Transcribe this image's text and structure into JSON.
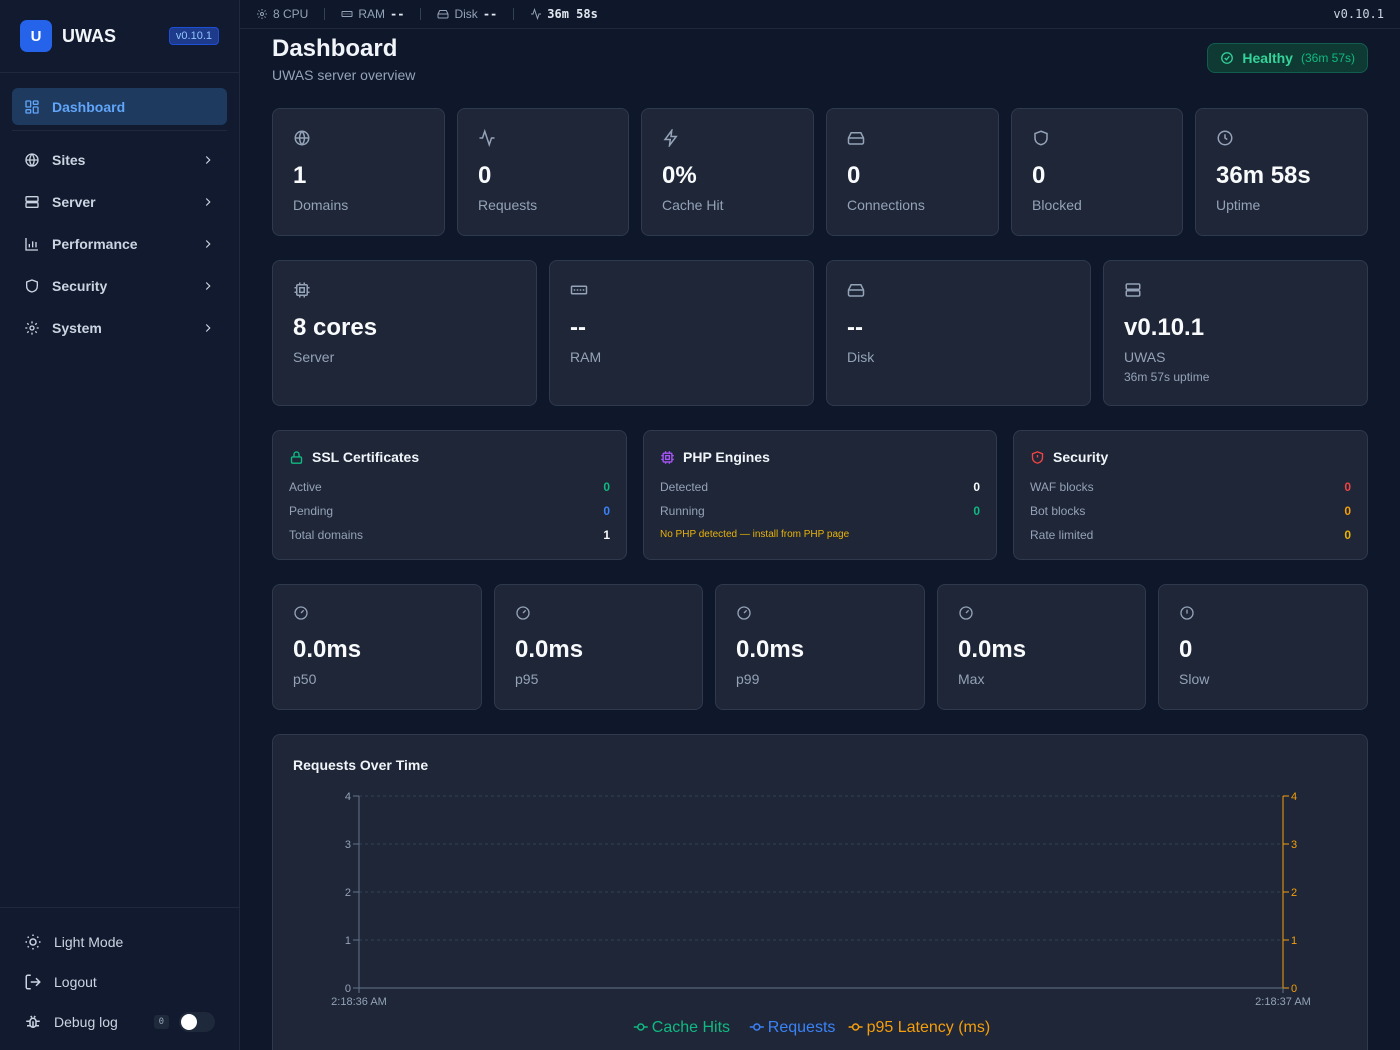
{
  "sidebar": {
    "logo_letter": "U",
    "brand": "UWAS",
    "version_badge": "v0.10.1",
    "nav": [
      {
        "label": "Dashboard",
        "icon": "dashboard-icon",
        "active": true
      },
      {
        "label": "Sites",
        "icon": "globe-icon"
      },
      {
        "label": "Server",
        "icon": "server-icon"
      },
      {
        "label": "Performance",
        "icon": "bar-chart-icon"
      },
      {
        "label": "Security",
        "icon": "shield-icon"
      },
      {
        "label": "System",
        "icon": "gear-icon"
      }
    ],
    "bottom": {
      "light_mode": "Light Mode",
      "logout": "Logout",
      "debug_log": "Debug log",
      "debug_count": "0",
      "debug_enabled": false
    }
  },
  "topbar": {
    "cpu": "8 CPU",
    "ram_label": "RAM",
    "ram_value": "--",
    "disk_label": "Disk",
    "disk_value": "--",
    "uptime": "36m 58s",
    "version": "v0.10.1"
  },
  "header": {
    "title": "Dashboard",
    "subtitle": "UWAS server overview",
    "health_label": "Healthy",
    "health_uptime": "(36m 57s)"
  },
  "stats_row1": [
    {
      "value": "1",
      "label": "Domains",
      "icon": "globe-icon"
    },
    {
      "value": "0",
      "label": "Requests",
      "icon": "activity-icon"
    },
    {
      "value": "0%",
      "label": "Cache Hit",
      "icon": "bolt-icon"
    },
    {
      "value": "0",
      "label": "Connections",
      "icon": "hard-drive-icon"
    },
    {
      "value": "0",
      "label": "Blocked",
      "icon": "shield-icon"
    },
    {
      "value": "36m 58s",
      "label": "Uptime",
      "icon": "clock-icon"
    }
  ],
  "stats_row2": [
    {
      "value": "8 cores",
      "label": "Server",
      "icon": "cpu-icon"
    },
    {
      "value": "--",
      "label": "RAM",
      "icon": "memory-icon"
    },
    {
      "value": "--",
      "label": "Disk",
      "icon": "hard-drive-icon"
    },
    {
      "value": "v0.10.1",
      "label": "UWAS",
      "sub": "36m 57s uptime",
      "icon": "server-icon"
    }
  ],
  "ssl": {
    "title": "SSL Certificates",
    "rows": [
      {
        "label": "Active",
        "value": "0",
        "color": "#10b981"
      },
      {
        "label": "Pending",
        "value": "0",
        "color": "#3b82f6"
      },
      {
        "label": "Total domains",
        "value": "1",
        "color": "#f8fafc"
      }
    ]
  },
  "php": {
    "title": "PHP Engines",
    "rows": [
      {
        "label": "Detected",
        "value": "0",
        "color": "#f8fafc"
      },
      {
        "label": "Running",
        "value": "0",
        "color": "#10b981"
      }
    ],
    "warning": "No PHP detected — install from PHP page"
  },
  "security": {
    "title": "Security",
    "rows": [
      {
        "label": "WAF blocks",
        "value": "0",
        "color": "#ef4444"
      },
      {
        "label": "Bot blocks",
        "value": "0",
        "color": "#f59e0b"
      },
      {
        "label": "Rate limited",
        "value": "0",
        "color": "#eab308"
      }
    ]
  },
  "latency": [
    {
      "value": "0.0ms",
      "label": "p50",
      "icon": "gauge-icon"
    },
    {
      "value": "0.0ms",
      "label": "p95",
      "icon": "gauge-icon"
    },
    {
      "value": "0.0ms",
      "label": "p99",
      "icon": "gauge-icon"
    },
    {
      "value": "0.0ms",
      "label": "Max",
      "icon": "gauge-icon"
    },
    {
      "value": "0",
      "label": "Slow",
      "icon": "alert-circle-icon"
    }
  ],
  "chart_data": {
    "type": "line",
    "title": "Requests Over Time",
    "x": [
      "2:18:36 AM",
      "2:18:37 AM"
    ],
    "y_left_ticks": [
      "0",
      "1",
      "2",
      "3",
      "4"
    ],
    "y_right_ticks": [
      "0",
      "1",
      "2",
      "3",
      "4"
    ],
    "ylim": [
      0,
      4
    ],
    "grid": true,
    "legend_position": "bottom",
    "series": [
      {
        "name": "Cache Hits",
        "color": "#10b981",
        "values": []
      },
      {
        "name": "Requests",
        "color": "#3b82f6",
        "values": []
      },
      {
        "name": "p95 Latency (ms)",
        "color": "#f59e0b",
        "values": []
      }
    ]
  }
}
